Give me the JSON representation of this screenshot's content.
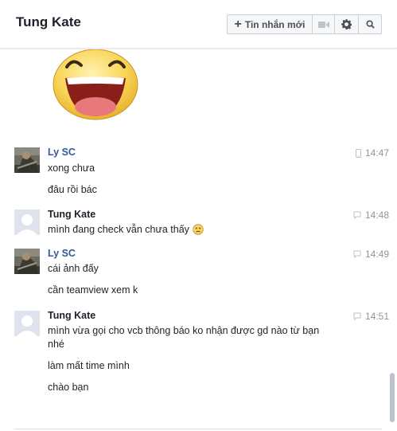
{
  "header": {
    "title": "Tung Kate",
    "new_message_label": "Tin nhắn mới"
  },
  "messages": [
    {
      "sender": "Ly SC",
      "time": "14:47",
      "lines": [
        "xong chưa",
        "đâu rồi bác"
      ]
    },
    {
      "sender": "Tung Kate",
      "time": "14:48",
      "lines": [
        "mình đang check vẫn chưa thấy"
      ]
    },
    {
      "sender": "Ly SC",
      "time": "14:49",
      "lines": [
        "cái ảnh đấy",
        "cần teamview xem k"
      ]
    },
    {
      "sender": "Tung Kate",
      "time": "14:51",
      "lines": [
        "mình vừa gọi cho vcb thông báo ko nhận được gd nào từ bạn",
        "nhé",
        "làm mất time mình",
        "chào bạn"
      ]
    }
  ],
  "icons": {
    "new_message": "plus-icon",
    "video": "video-camera-icon",
    "settings": "gear-icon",
    "search": "search-icon",
    "sent_mobile": "mobile-phone-icon",
    "sent_web": "chat-bubble-icon",
    "sticker": "laughing-face-sticker",
    "emoji": "sad-face-emoji"
  },
  "colors": {
    "friend_name": "#365899",
    "own_name": "#1d2129",
    "timestamp": "#90949c"
  }
}
